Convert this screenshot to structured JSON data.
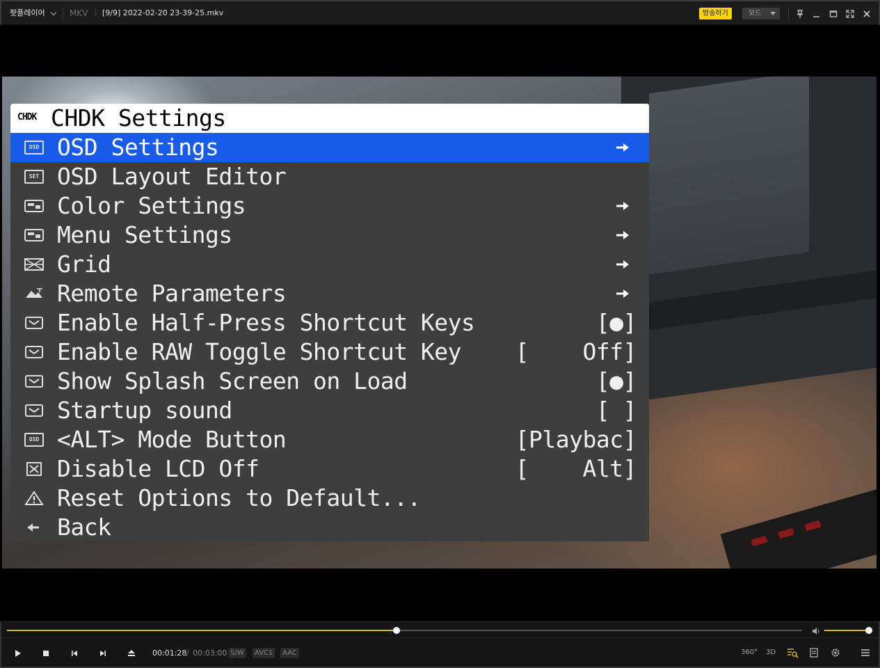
{
  "titlebar": {
    "app_name": "팟플레이어",
    "file_format": "MKV",
    "format_separator": "|",
    "file_title": "[9/9] 2022-02-20 23-39-25.mkv",
    "broadcast_label": "방송하기",
    "mode_label": "모드",
    "window_buttons": [
      "pin-icon",
      "minimize-icon",
      "maximize-icon",
      "fullscreen-icon",
      "close-icon"
    ]
  },
  "menu": {
    "logo": "CHDK",
    "title": "CHDK Settings",
    "selected_index": 0,
    "items": [
      {
        "icon": "osd-icon",
        "icon_text": "OSD",
        "label": "OSD Settings",
        "value": "",
        "has_arrow": true
      },
      {
        "icon": "set-icon",
        "icon_text": "SET",
        "label": "OSD Layout Editor",
        "value": "",
        "has_arrow": false
      },
      {
        "icon": "palette-icon",
        "icon_text": "",
        "label": "Color Settings",
        "value": "",
        "has_arrow": true
      },
      {
        "icon": "palette-icon",
        "icon_text": "",
        "label": "Menu Settings",
        "value": "",
        "has_arrow": true
      },
      {
        "icon": "grid-icon",
        "icon_text": "",
        "label": "Grid",
        "value": "",
        "has_arrow": true
      },
      {
        "icon": "remote-icon",
        "icon_text": "",
        "label": "Remote Parameters",
        "value": "",
        "has_arrow": true
      },
      {
        "icon": "checkbox-icon",
        "icon_text": "",
        "label": "Enable Half-Press Shortcut Keys",
        "value": "[●]",
        "has_arrow": false
      },
      {
        "icon": "checkbox-icon",
        "icon_text": "",
        "label": "Enable RAW Toggle Shortcut Key",
        "value": "[    Off]",
        "has_arrow": false
      },
      {
        "icon": "checkbox-icon",
        "icon_text": "",
        "label": "Show Splash Screen on Load",
        "value": "[●]",
        "has_arrow": false
      },
      {
        "icon": "checkbox-icon",
        "icon_text": "",
        "label": "Startup sound",
        "value": "[ ]",
        "has_arrow": false
      },
      {
        "icon": "osd-icon",
        "icon_text": "OSD",
        "label": "<ALT> Mode Button",
        "value": "[Playbac]",
        "has_arrow": false
      },
      {
        "icon": "x-box-icon",
        "icon_text": "",
        "label": "Disable LCD Off",
        "value": "[    Alt]",
        "has_arrow": false
      },
      {
        "icon": "warning-icon",
        "icon_text": "",
        "label": "Reset Options to Default...",
        "value": "",
        "has_arrow": false
      },
      {
        "icon": "back-arrow-icon",
        "icon_text": "",
        "label": "Back",
        "value": "",
        "has_arrow": false
      }
    ]
  },
  "player": {
    "time_current": "00:01:28",
    "time_separator": "/",
    "time_total": "00:03:00",
    "seek_fraction": 0.49,
    "volume_fraction": 1.0,
    "codecs": [
      "S/W",
      "AVC1",
      "AAC"
    ],
    "right_controls": [
      {
        "name": "360-icon",
        "text": "360°"
      },
      {
        "name": "3d-icon",
        "text": "3D"
      },
      {
        "name": "playlist-search-icon",
        "text": ""
      },
      {
        "name": "chapter-icon",
        "text": ""
      },
      {
        "name": "settings-icon",
        "text": ""
      },
      {
        "name": "menu-icon",
        "text": ""
      }
    ]
  },
  "colors": {
    "accent": "#d8b830",
    "menu_selected": "#1a5cea",
    "menu_bg": "#3e3e3e",
    "broadcast": "#ffd400"
  }
}
